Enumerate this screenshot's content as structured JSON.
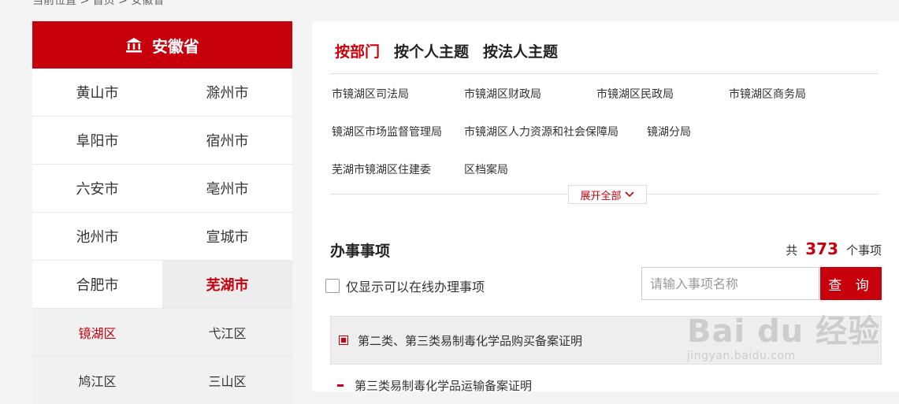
{
  "breadcrumb": "当前位置 > 首页 > 安徽省",
  "province": {
    "name": "安徽省",
    "icon": "government-building-icon"
  },
  "cities": [
    [
      "黄山市",
      "滁州市"
    ],
    [
      "阜阳市",
      "宿州市"
    ],
    [
      "六安市",
      "亳州市"
    ],
    [
      "池州市",
      "宣城市"
    ],
    [
      "合肥市",
      "芜湖市"
    ]
  ],
  "active_city": "芜湖市",
  "districts": [
    [
      "镜湖区",
      "弋江区"
    ],
    [
      "鸠江区",
      "三山区"
    ]
  ],
  "active_district": "镜湖区",
  "tabs": [
    "按部门",
    "按个人主题",
    "按法人主题"
  ],
  "active_tab": "按部门",
  "departments": [
    "市镜湖区司法局",
    "市镜湖区财政局",
    "市镜湖区民政局",
    "市镜湖区商务局",
    "镜湖区市场监督管理局",
    "市镜湖区人力资源和社会保障局",
    "镜湖分局",
    "芜湖市镜湖区住建委",
    "区档案局"
  ],
  "expand_label": "展开全部",
  "section": {
    "title": "办事事项",
    "count_prefix": "共",
    "count": "373",
    "count_suffix": "个事项",
    "online_only_label": "仅显示可以在线办理事项",
    "search_placeholder": "请输入事项名称",
    "search_button": "查 询"
  },
  "items": [
    "第二类、第三类易制毒化学品购买备案证明",
    "第三类易制毒化学品运输备案证明"
  ],
  "watermark": {
    "brand": "Bai du 经验",
    "url": "jingyan.baidu.com"
  },
  "colors": {
    "brand_red": "#c8000b"
  }
}
